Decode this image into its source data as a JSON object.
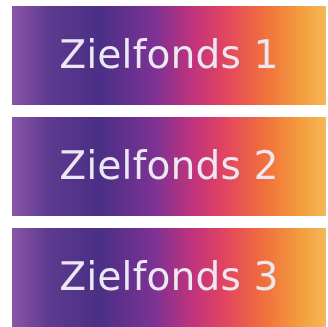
{
  "funds": [
    {
      "label": "Zielfonds 1"
    },
    {
      "label": "Zielfonds 2"
    },
    {
      "label": "Zielfonds 3"
    }
  ],
  "colors": {
    "gradient_start": "#8a55a7",
    "gradient_purple": "#4a2f86",
    "gradient_magenta": "#c2337b",
    "gradient_orange": "#f06e3d",
    "gradient_end": "#f6b65a",
    "label_text": "#ece7f2"
  }
}
